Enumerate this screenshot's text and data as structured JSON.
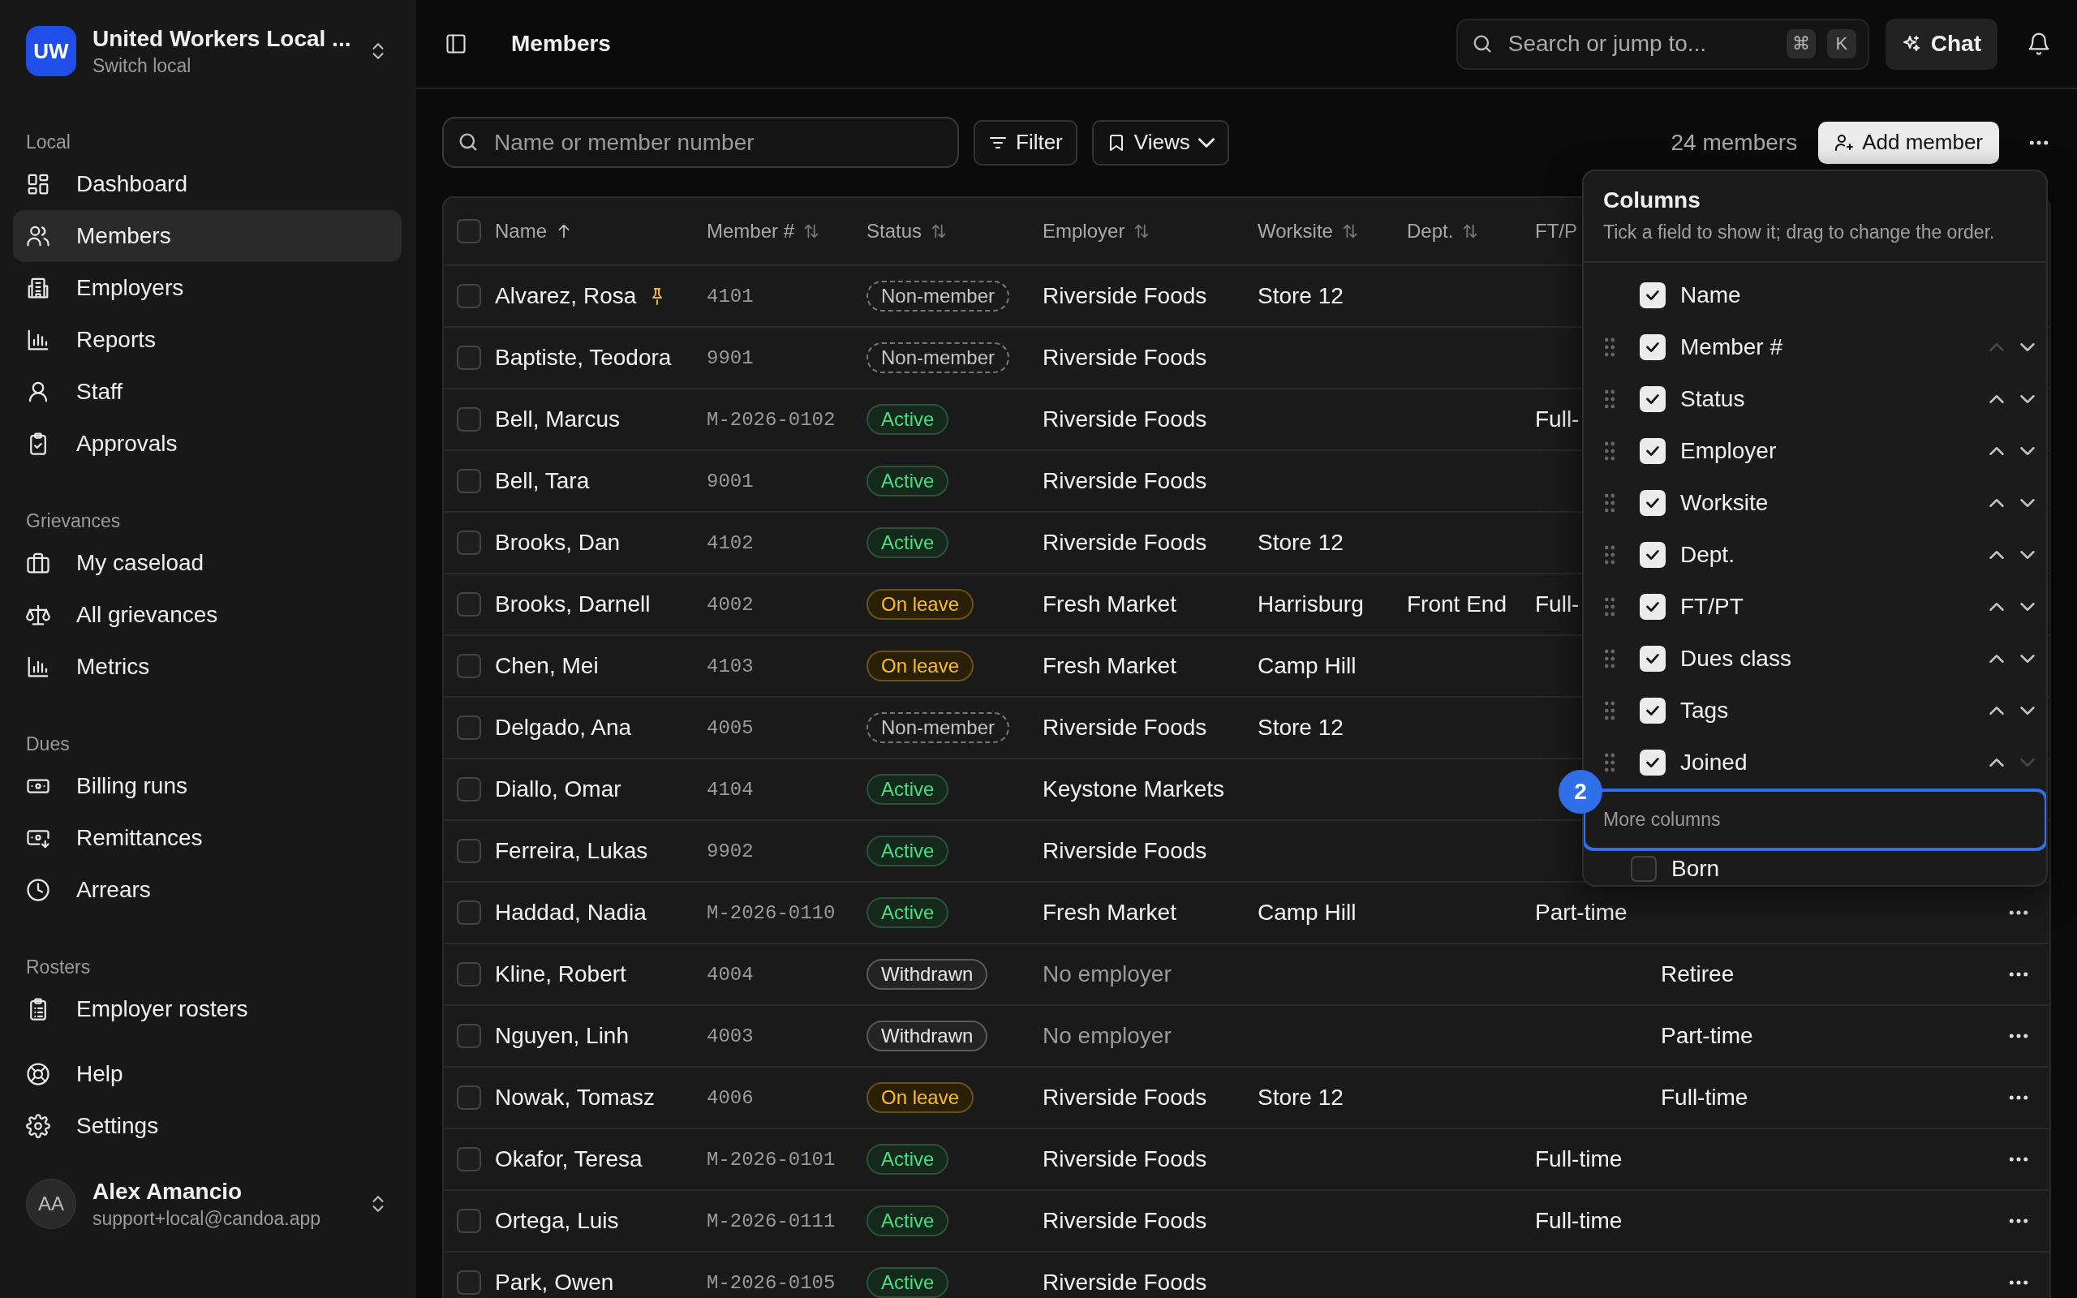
{
  "sidebar": {
    "org": {
      "initials": "UW",
      "name": "United Workers Local ...",
      "subtitle": "Switch local"
    },
    "sections": [
      {
        "label": "Local",
        "items": [
          {
            "label": "Dashboard",
            "selected": false
          },
          {
            "label": "Members",
            "selected": true
          },
          {
            "label": "Employers",
            "selected": false
          },
          {
            "label": "Reports",
            "selected": false
          },
          {
            "label": "Staff",
            "selected": false
          },
          {
            "label": "Approvals",
            "selected": false
          }
        ]
      },
      {
        "label": "Grievances",
        "items": [
          {
            "label": "My caseload",
            "selected": false
          },
          {
            "label": "All grievances",
            "selected": false
          },
          {
            "label": "Metrics",
            "selected": false
          }
        ]
      },
      {
        "label": "Dues",
        "items": [
          {
            "label": "Billing runs",
            "selected": false
          },
          {
            "label": "Remittances",
            "selected": false
          },
          {
            "label": "Arrears",
            "selected": false
          }
        ]
      },
      {
        "label": "Rosters",
        "items": [
          {
            "label": "Employer rosters",
            "selected": false
          }
        ]
      },
      {
        "items": [
          {
            "label": "Help",
            "selected": false
          },
          {
            "label": "Settings",
            "selected": false
          }
        ]
      }
    ],
    "user": {
      "initials": "AA",
      "name": "Alex Amancio",
      "email": "support+local@candoa.app"
    }
  },
  "topbar": {
    "title": "Members",
    "search": {
      "placeholder": "Search or jump to...",
      "keys": [
        "⌘",
        "K"
      ]
    },
    "chat_button": "Chat"
  },
  "toolbar": {
    "search": {
      "placeholder": "Name or member number"
    },
    "filter_button": "Filter",
    "views_button": "Views",
    "count": "24 members",
    "add_button": "Add member"
  },
  "table": {
    "select_all_checked": false,
    "columns": [
      {
        "label": "Name",
        "sorted": true
      },
      {
        "label": "Member #",
        "sorted": false
      },
      {
        "label": "Status",
        "sorted": false
      },
      {
        "label": "Employer",
        "sorted": false
      },
      {
        "label": "Worksite",
        "sorted": false
      },
      {
        "label": "Dept.",
        "sorted": false
      },
      {
        "label": "FT/P"
      }
    ],
    "rows": [
      {
        "checked": false,
        "name": "Alvarez, Rosa",
        "pinned": true,
        "member_no": "4101",
        "status": {
          "label": "Non-member",
          "kind": "non-member"
        },
        "employer": "Riverside Foods",
        "worksite": "Store 12"
      },
      {
        "checked": false,
        "name": "Baptiste, Teodora",
        "member_no": "9901",
        "status": {
          "label": "Non-member",
          "kind": "non-member"
        },
        "employer": "Riverside Foods"
      },
      {
        "checked": false,
        "name": "Bell, Marcus",
        "member_no": "M-2026-0102",
        "status": {
          "label": "Active",
          "kind": "active"
        },
        "employer": "Riverside Foods",
        "ft_pt": "Full-"
      },
      {
        "checked": false,
        "name": "Bell, Tara",
        "member_no": "9001",
        "status": {
          "label": "Active",
          "kind": "active"
        },
        "employer": "Riverside Foods"
      },
      {
        "checked": false,
        "name": "Brooks, Dan",
        "member_no": "4102",
        "status": {
          "label": "Active",
          "kind": "active"
        },
        "employer": "Riverside Foods",
        "worksite": "Store 12"
      },
      {
        "checked": false,
        "name": "Brooks, Darnell",
        "member_no": "4002",
        "status": {
          "label": "On leave",
          "kind": "on-leave"
        },
        "employer": "Fresh Market",
        "worksite": "Harrisburg",
        "dept": "Front End",
        "ft_pt": "Full-"
      },
      {
        "checked": false,
        "name": "Chen, Mei",
        "member_no": "4103",
        "status": {
          "label": "On leave",
          "kind": "on-leave"
        },
        "employer": "Fresh Market",
        "worksite": "Camp Hill"
      },
      {
        "checked": false,
        "name": "Delgado, Ana",
        "member_no": "4005",
        "status": {
          "label": "Non-member",
          "kind": "non-member"
        },
        "employer": "Riverside Foods",
        "worksite": "Store 12"
      },
      {
        "checked": false,
        "name": "Diallo, Omar",
        "member_no": "4104",
        "status": {
          "label": "Active",
          "kind": "active"
        },
        "employer": "Keystone Markets"
      },
      {
        "checked": false,
        "name": "Ferreira, Lukas",
        "member_no": "9902",
        "status": {
          "label": "Active",
          "kind": "active"
        },
        "employer": "Riverside Foods"
      },
      {
        "checked": false,
        "name": "Haddad, Nadia",
        "member_no": "M-2026-0110",
        "status": {
          "label": "Active",
          "kind": "active"
        },
        "employer": "Fresh Market",
        "worksite": "Camp Hill",
        "ft_pt": "Part-time"
      },
      {
        "checked": false,
        "name": "Kline, Robert",
        "member_no": "4004",
        "status": {
          "label": "Withdrawn",
          "kind": "withdrawn"
        },
        "employer": "No employer",
        "employer_muted": true,
        "dues_class": "Retiree"
      },
      {
        "checked": false,
        "name": "Nguyen, Linh",
        "member_no": "4003",
        "status": {
          "label": "Withdrawn",
          "kind": "withdrawn"
        },
        "employer": "No employer",
        "employer_muted": true,
        "dues_class": "Part-time"
      },
      {
        "checked": false,
        "name": "Nowak, Tomasz",
        "member_no": "4006",
        "status": {
          "label": "On leave",
          "kind": "on-leave"
        },
        "employer": "Riverside Foods",
        "worksite": "Store 12",
        "dues_class": "Full-time"
      },
      {
        "checked": false,
        "name": "Okafor, Teresa",
        "member_no": "M-2026-0101",
        "status": {
          "label": "Active",
          "kind": "active"
        },
        "employer": "Riverside Foods",
        "ft_pt": "Full-time"
      },
      {
        "checked": false,
        "name": "Ortega, Luis",
        "member_no": "M-2026-0111",
        "status": {
          "label": "Active",
          "kind": "active"
        },
        "employer": "Riverside Foods",
        "ft_pt": "Full-time"
      },
      {
        "checked": false,
        "name": "Park, Owen",
        "member_no": "M-2026-0105",
        "status": {
          "label": "Active",
          "kind": "active"
        },
        "employer": "Riverside Foods"
      }
    ]
  },
  "columns_panel": {
    "title": "Columns",
    "hint": "Tick a field to show it; drag to change the order.",
    "items": [
      {
        "label": "Name",
        "checked": true,
        "movable": false
      },
      {
        "label": "Member #",
        "checked": true,
        "movable": true,
        "can_move_up": false,
        "can_move_down": true
      },
      {
        "label": "Status",
        "checked": true,
        "movable": true,
        "can_move_up": true,
        "can_move_down": true
      },
      {
        "label": "Employer",
        "checked": true,
        "movable": true,
        "can_move_up": true,
        "can_move_down": true
      },
      {
        "label": "Worksite",
        "checked": true,
        "movable": true,
        "can_move_up": true,
        "can_move_down": true
      },
      {
        "label": "Dept.",
        "checked": true,
        "movable": true,
        "can_move_up": true,
        "can_move_down": true
      },
      {
        "label": "FT/PT",
        "checked": true,
        "movable": true,
        "can_move_up": true,
        "can_move_down": true
      },
      {
        "label": "Dues class",
        "checked": true,
        "movable": true,
        "can_move_up": true,
        "can_move_down": true
      },
      {
        "label": "Tags",
        "checked": true,
        "movable": true,
        "can_move_up": true,
        "can_move_down": true
      },
      {
        "label": "Joined",
        "checked": true,
        "movable": true,
        "can_move_up": true,
        "can_move_down": false
      }
    ],
    "more": {
      "label": "More columns",
      "focused": true,
      "items": [
        {
          "label": "Born",
          "checked": false
        }
      ]
    },
    "step_badge": "2"
  }
}
